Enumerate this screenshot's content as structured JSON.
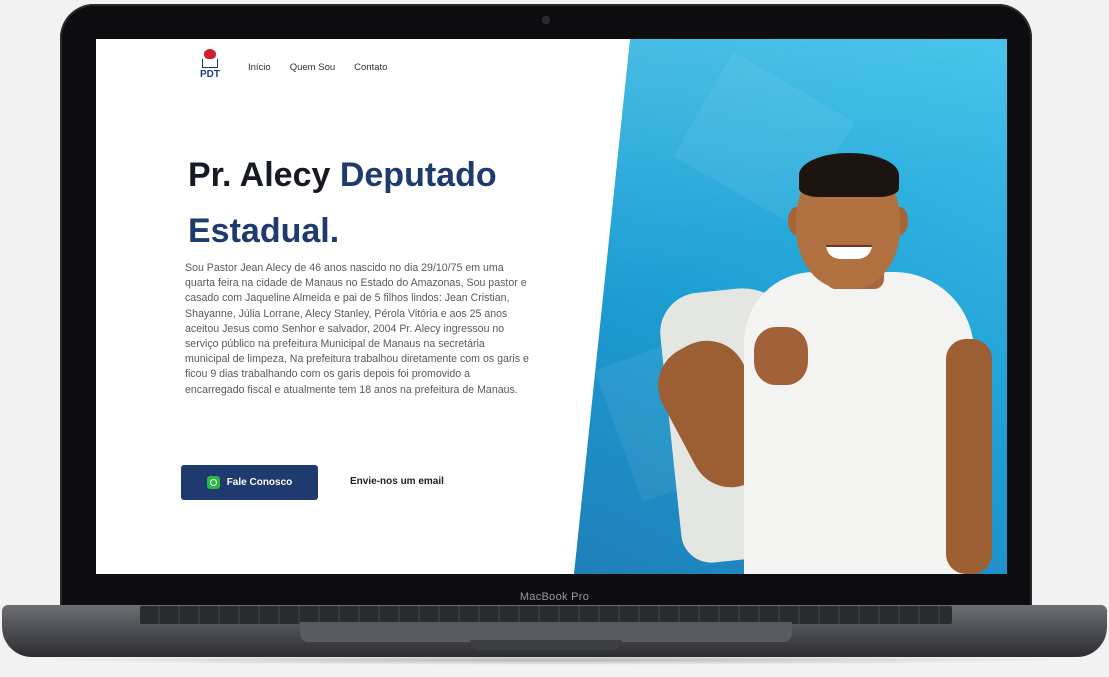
{
  "device": {
    "label": "MacBook Pro"
  },
  "nav": {
    "logo_text": "PDT",
    "items": [
      {
        "label": "Início"
      },
      {
        "label": "Quem Sou"
      },
      {
        "label": "Contato"
      }
    ]
  },
  "hero": {
    "title_part1": "Pr. Alecy ",
    "title_part2": "Deputado Estadual.",
    "bio": "Sou Pastor Jean Alecy de 46 anos nascido no dia 29/10/75 em uma quarta feira na cidade de Manaus no Estado do Amazonas, Sou pastor e casado com Jaqueline Almeida e pai de 5 filhos lindos: Jean Cristian, Shayanne, Júlia Lorrane, Alecy Stanley, Pérola Vitória e aos 25 anos aceitou Jesus como Senhor e salvador, 2004 Pr. Alecy ingressou no serviço público na prefeitura Municipal de Manaus na secretária municipal de limpeza, Na prefeitura trabalhou diretamente com os garis e ficou 9 dias trabalhando com os garis depois foi promovido a encarregado fiscal e atualmente tem 18 anos na prefeitura de Manaus.",
    "primary_button": "Fale Conosco",
    "primary_button_icon": "whatsapp-icon",
    "secondary_link": "Envie-nos um email"
  },
  "colors": {
    "brand_navy": "#1e3a6e",
    "whatsapp_green": "#2bb741",
    "hero_blue": "#1d9fd4"
  }
}
